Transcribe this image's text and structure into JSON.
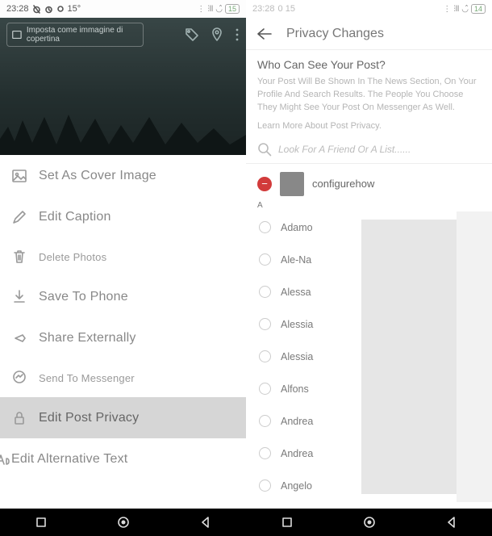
{
  "left": {
    "status": {
      "time": "23:28",
      "temp": "15°",
      "batt": "15"
    },
    "hero": {
      "chip_text": "Imposta come immagine di copertina"
    },
    "menu": [
      {
        "name": "set-cover",
        "label": "Set As Cover Image",
        "icon": "image-icon",
        "small": false
      },
      {
        "name": "edit-caption",
        "label": "Edit Caption",
        "icon": "pencil-icon",
        "small": false
      },
      {
        "name": "delete-photos",
        "label": "Delete Photos",
        "icon": "trash-icon",
        "small": true
      },
      {
        "name": "save-phone",
        "label": "Save To Phone",
        "icon": "download-icon",
        "small": false
      },
      {
        "name": "share-ext",
        "label": "Share Externally",
        "icon": "share-icon",
        "small": false
      },
      {
        "name": "send-messenger",
        "label": "Send To Messenger",
        "icon": "messenger-icon",
        "small": true
      },
      {
        "name": "edit-privacy",
        "label": "Edit Post Privacy",
        "icon": "lock-icon",
        "small": false,
        "active": true
      },
      {
        "name": "edit-alt",
        "label": "Edit Alternative Text",
        "icon": "alt-text-icon",
        "small": false,
        "cut": true
      }
    ]
  },
  "right": {
    "status": {
      "time": "23:28",
      "extra": "0 15",
      "batt": "14"
    },
    "title": "Privacy Changes",
    "heading": "Who Can See Your Post?",
    "desc": "Your Post Will Be Shown In The News Section, On Your Profile And Search Results. The People You Choose They Might See Your Post On Messenger As Well.",
    "link": "Learn More About Post Privacy.",
    "search_placeholder": "Look For A Friend Or A List......",
    "selected": {
      "name": "configurehow"
    },
    "alpha": "A",
    "friends": [
      "Adamo",
      "Ale-Na",
      "Alessa",
      "Alessia",
      "Alessia",
      "Alfons",
      "Andrea",
      "Andrea",
      "Angelo"
    ]
  }
}
